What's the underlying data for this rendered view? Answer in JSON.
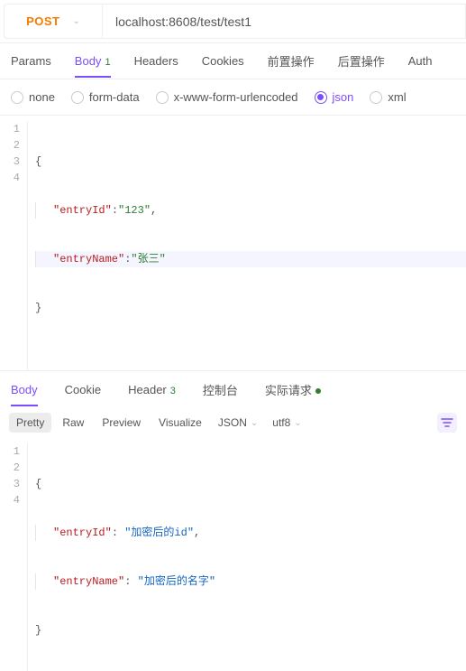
{
  "method": "POST",
  "url": "localhost:8608/test/test1",
  "request": {
    "tabs": [
      {
        "label": "Params",
        "badge": ""
      },
      {
        "label": "Body",
        "badge": "1"
      },
      {
        "label": "Headers",
        "badge": ""
      },
      {
        "label": "Cookies",
        "badge": ""
      },
      {
        "label": "前置操作",
        "badge": ""
      },
      {
        "label": "后置操作",
        "badge": ""
      },
      {
        "label": "Auth",
        "badge": ""
      }
    ],
    "activeTab": 1,
    "bodyTypes": [
      {
        "label": "none"
      },
      {
        "label": "form-data"
      },
      {
        "label": "x-www-form-urlencoded"
      },
      {
        "label": "json"
      },
      {
        "label": "xml"
      }
    ],
    "selectedBodyType": 3,
    "body": {
      "entryId": "123",
      "entryName": "张三"
    }
  },
  "response": {
    "tabs": [
      {
        "label": "Body",
        "badge": ""
      },
      {
        "label": "Cookie",
        "badge": ""
      },
      {
        "label": "Header",
        "badge": "3"
      },
      {
        "label": "控制台",
        "badge": ""
      },
      {
        "label": "实际请求",
        "dot": true
      }
    ],
    "activeTab": 0,
    "viewModes": [
      "Pretty",
      "Raw",
      "Preview",
      "Visualize"
    ],
    "activeViewMode": 0,
    "format": "JSON",
    "encoding": "utf8",
    "body": {
      "entryId": "加密后的id",
      "entryName": "加密后的名字"
    }
  }
}
